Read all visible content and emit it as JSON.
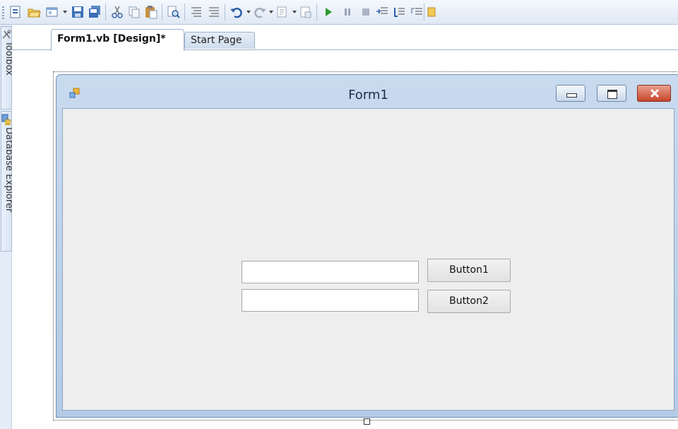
{
  "toolbar": {
    "icons": [
      "add-item-icon",
      "open-file-icon",
      "add-new-item-icon",
      "save-icon",
      "save-all-icon",
      "cut-icon",
      "copy-icon",
      "paste-icon",
      "find-icon",
      "comment-icon",
      "uncomment-icon",
      "undo-icon",
      "redo-icon",
      "navigate-backward-icon",
      "navigate-forward-icon",
      "start-debugging-icon",
      "break-all-icon",
      "stop-debugging-icon",
      "step-into-icon",
      "step-over-icon",
      "step-out-icon",
      "output-window-icon"
    ]
  },
  "dock": {
    "toolbox_label": "Toolbox",
    "database_explorer_label": "Database Explorer"
  },
  "tabs": {
    "design_label": "Form1.vb [Design]*",
    "start_label": "Start Page"
  },
  "form": {
    "title": "Form1",
    "button1_label": "Button1",
    "button2_label": "Button2",
    "textbox1_value": "",
    "textbox2_value": ""
  }
}
